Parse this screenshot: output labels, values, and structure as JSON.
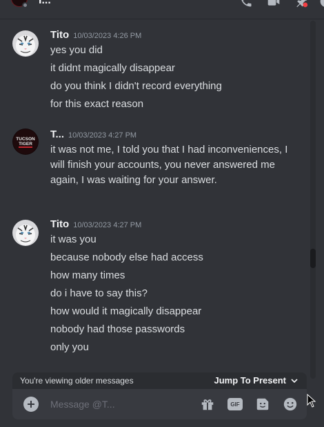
{
  "topbar": {
    "channel_name": "I...",
    "icons": [
      "phone-call-icon",
      "video-call-icon",
      "pin-icon",
      "help-icon"
    ]
  },
  "messages": [
    {
      "author": "Tito",
      "timestamp": "10/03/2023 4:26 PM",
      "avatar": "white-tiger-avatar",
      "lines": [
        "yes you did",
        "it didnt magically disappear",
        "do you think I didn't record everything",
        "for this exact reason"
      ]
    },
    {
      "author": "T...",
      "timestamp": "10/03/2023 4:27 PM",
      "avatar": "tucson-tiger-avatar",
      "paragraph": "it was not me, I told you that I had inconveniences, I will finish your accounts, you never answered me again, I was waiting for your answer."
    },
    {
      "author": "Tito",
      "timestamp": "10/03/2023 4:27 PM",
      "avatar": "white-tiger-avatar",
      "lines": [
        "it was you",
        "because nobody else had access",
        "how many times",
        "do i have to say this?",
        "how would it magically disappear",
        "nobody had those passwords",
        "only you"
      ]
    }
  ],
  "older_bar": {
    "text": "You're viewing older messages",
    "jump_label": "Jump To Present"
  },
  "composer": {
    "placeholder": "Message @T...",
    "gif_label": "GIF",
    "tools": [
      "gift-icon",
      "gif-icon",
      "sticker-icon",
      "emoji-icon"
    ]
  },
  "colors": {
    "background": "#313338",
    "composer": "#383a40",
    "older_bar": "#2b2d31",
    "text": "#dbdee1",
    "muted": "#949ba4"
  }
}
